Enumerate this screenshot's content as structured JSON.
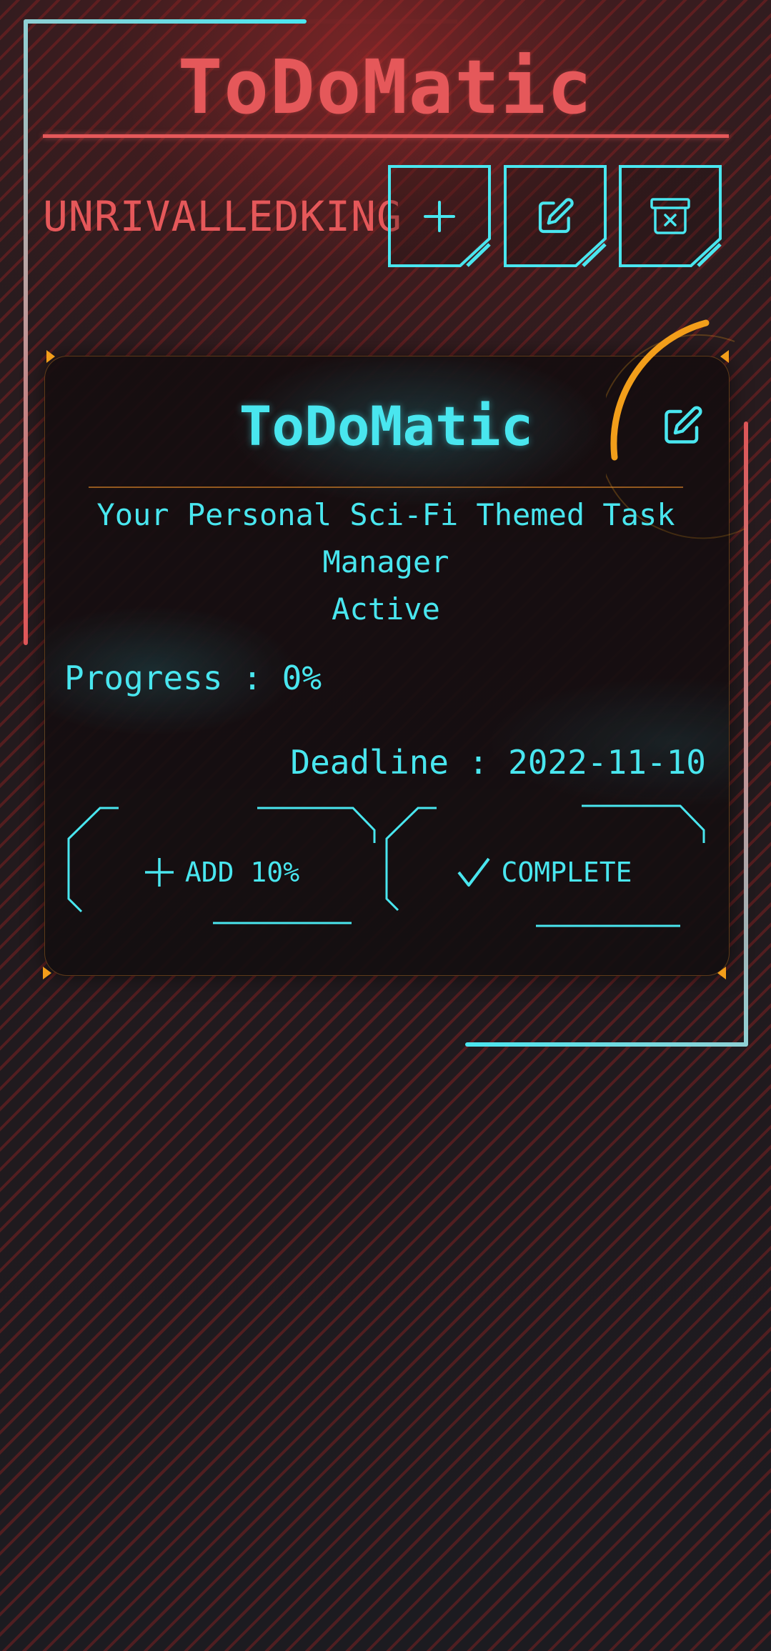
{
  "theme": {
    "accent_red": "#e5585a",
    "accent_cyan": "#49e6ef",
    "accent_orange": "#f29e1a"
  },
  "header": {
    "app_title": "ToDoMatic",
    "username": "UNRIVALLEDKING",
    "buttons": [
      {
        "icon": "plus-icon",
        "action": "add-task"
      },
      {
        "icon": "pencil-square-icon",
        "action": "edit-task"
      },
      {
        "icon": "archive-x-icon",
        "action": "delete-task"
      }
    ]
  },
  "task_card": {
    "title": "ToDoMatic",
    "description": "Your Personal Sci-Fi Themed Task Manager",
    "status": "Active",
    "progress_label": "Progress : 0%",
    "progress_percent": 0,
    "deadline_label": "Deadline : 2022-11-10",
    "edit_icon": "pencil-square-icon",
    "actions": [
      {
        "label": "ADD 10%",
        "icon": "plus-icon"
      },
      {
        "label": "COMPLETE",
        "icon": "check-icon"
      }
    ]
  }
}
